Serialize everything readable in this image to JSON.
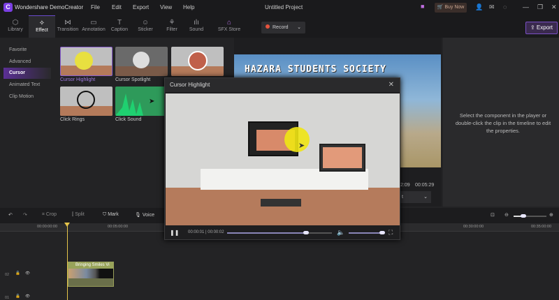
{
  "app": {
    "name": "Wondershare DemoCreator",
    "logo_letter": "C",
    "project_title": "Untitled Project",
    "menu": [
      "File",
      "Edit",
      "Export",
      "View",
      "Help"
    ],
    "buy_now": "Buy Now"
  },
  "toolbar": {
    "tabs": [
      {
        "label": "Library",
        "icon": "cube-icon"
      },
      {
        "label": "Effect",
        "icon": "magic-wand-icon"
      },
      {
        "label": "Transition",
        "icon": "transition-icon"
      },
      {
        "label": "Annotation",
        "icon": "annotation-icon"
      },
      {
        "label": "Caption",
        "icon": "caption-icon"
      },
      {
        "label": "Sticker",
        "icon": "sticker-icon"
      },
      {
        "label": "Filter",
        "icon": "filter-icon"
      },
      {
        "label": "Sound",
        "icon": "sound-icon"
      },
      {
        "label": "SFX Store",
        "icon": "store-icon"
      }
    ],
    "active": "Effect",
    "record": "Record",
    "export": "Export"
  },
  "sidebar": {
    "items": [
      "Favorite",
      "Advanced",
      "Cursor",
      "Animated Text",
      "Clip Motion"
    ],
    "active": "Cursor"
  },
  "effects": [
    "Cursor Highlight",
    "Cursor Spotlight",
    "",
    "Click Rings",
    "Click Sound"
  ],
  "preview": {
    "video_title": "HAZARA STUDENTS SOCIETY",
    "current_time": "2:09",
    "total_time": "00:05:29",
    "dropdown": "t"
  },
  "properties": {
    "message": "Select the component in the player or double-click the clip in the timeline to edit the properties."
  },
  "timeline": {
    "tools": [
      "Crop",
      "Split",
      "Mark",
      "Voice"
    ],
    "ruler": [
      "00:00:00:00",
      "00:05:00:00",
      "00:30:00:00",
      "00:35:00:00"
    ],
    "tracks": [
      "02",
      "01"
    ],
    "clip_name": "Bringing Smiles Vi",
    "zoom_level": 0.3
  },
  "modal": {
    "title": "Cursor Highlight",
    "time": "00:00:01 | 00:00:02",
    "progress": 0.75,
    "volume": 0.95
  },
  "colors": {
    "accent": "#7b3fe4",
    "playhead": "#e5c44a",
    "clip": "#98a35a"
  }
}
